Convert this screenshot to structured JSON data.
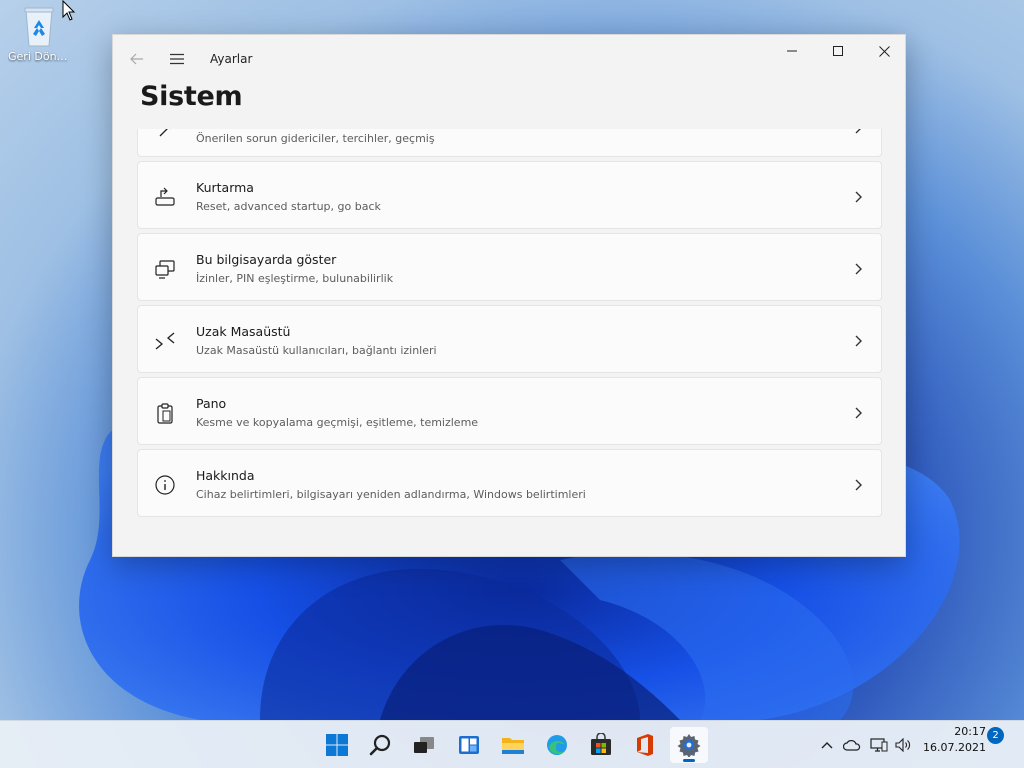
{
  "desktop": {
    "recycle_bin_label": "Geri Dönüşü..."
  },
  "window": {
    "app_title": "Ayarlar",
    "page_title": "Sistem",
    "controls": {
      "minimize_icon": "minimize-icon",
      "maximize_icon": "maximize-icon",
      "close_icon": "close-icon"
    }
  },
  "settings_items": [
    {
      "title": "",
      "subtitle": "Önerilen sorun gidericiler, tercihler, geçmiş",
      "icon": "troubleshoot-icon"
    },
    {
      "title": "Kurtarma",
      "subtitle": "Reset, advanced startup, go back",
      "icon": "recovery-icon"
    },
    {
      "title": "Bu bilgisayarda göster",
      "subtitle": "İzinler, PIN eşleştirme, bulunabilirlik",
      "icon": "projecting-icon"
    },
    {
      "title": "Uzak Masaüstü",
      "subtitle": "Uzak Masaüstü kullanıcıları, bağlantı izinleri",
      "icon": "remote-desktop-icon"
    },
    {
      "title": "Pano",
      "subtitle": "Kesme ve kopyalama geçmişi, eşitleme, temizleme",
      "icon": "clipboard-icon"
    },
    {
      "title": "Hakkında",
      "subtitle": "Cihaz belirtimleri, bilgisayarı yeniden adlandırma, Windows belirtimleri",
      "icon": "info-icon"
    }
  ],
  "taskbar": {
    "apps": [
      "start-icon",
      "search-icon",
      "task-view-icon",
      "widgets-icon",
      "file-explorer-icon",
      "edge-icon",
      "store-icon",
      "office-icon",
      "settings-icon"
    ],
    "active_app": "settings-icon",
    "clock_time": "20:17",
    "clock_date": "16.07.2021",
    "notification_count": "2"
  },
  "colors": {
    "accent": "#0067c0",
    "window_bg": "#f3f3f3",
    "card_bg": "#fbfbfb"
  }
}
